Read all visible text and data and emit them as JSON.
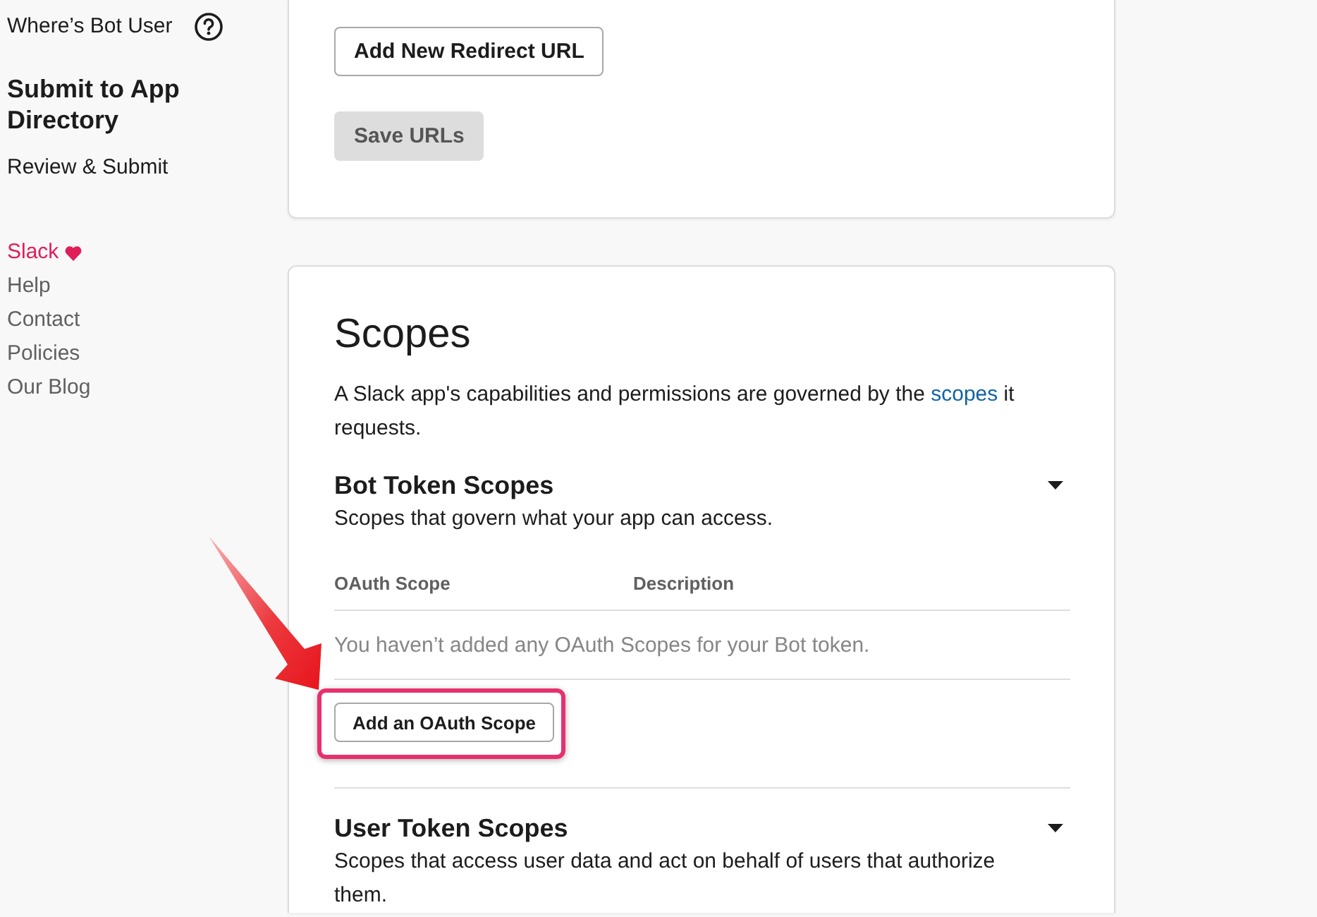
{
  "sidebar": {
    "items": [
      {
        "kind": "link_help",
        "label": "Where’s Bot User"
      },
      {
        "kind": "heading",
        "label": "Submit to App Directory"
      },
      {
        "kind": "link",
        "label": "Review & Submit"
      }
    ],
    "footer_links": [
      {
        "kind": "brand",
        "label": "Slack"
      },
      {
        "kind": "link",
        "label": "Help"
      },
      {
        "kind": "link",
        "label": "Contact"
      },
      {
        "kind": "link",
        "label": "Policies"
      },
      {
        "kind": "link",
        "label": "Our Blog"
      }
    ]
  },
  "redirect_urls": {
    "buttons": [
      {
        "label": "Add New Redirect URL",
        "disabled": false
      },
      {
        "label": "Save URLs",
        "disabled": true
      }
    ]
  },
  "scopes": {
    "title": "Scopes",
    "description": [
      {
        "kind": "text",
        "text": "A Slack app's capabilities and permissions are governed by the "
      },
      {
        "kind": "link",
        "text": "scopes"
      },
      {
        "kind": "text",
        "text": " it requests."
      }
    ],
    "sections": [
      {
        "title": "Bot Token Scopes",
        "subtitle": "Scopes that govern what your app can access.",
        "table": {
          "columns": [
            "OAuth Scope",
            "Description"
          ],
          "empty_message": "You haven’t added any OAuth Scopes for your Bot token."
        },
        "button": {
          "label": "Add an OAuth Scope",
          "highlighted": true
        }
      },
      {
        "title": "User Token Scopes",
        "subtitle": "Scopes that access user data and act on behalf of users that authorize them."
      }
    ]
  }
}
